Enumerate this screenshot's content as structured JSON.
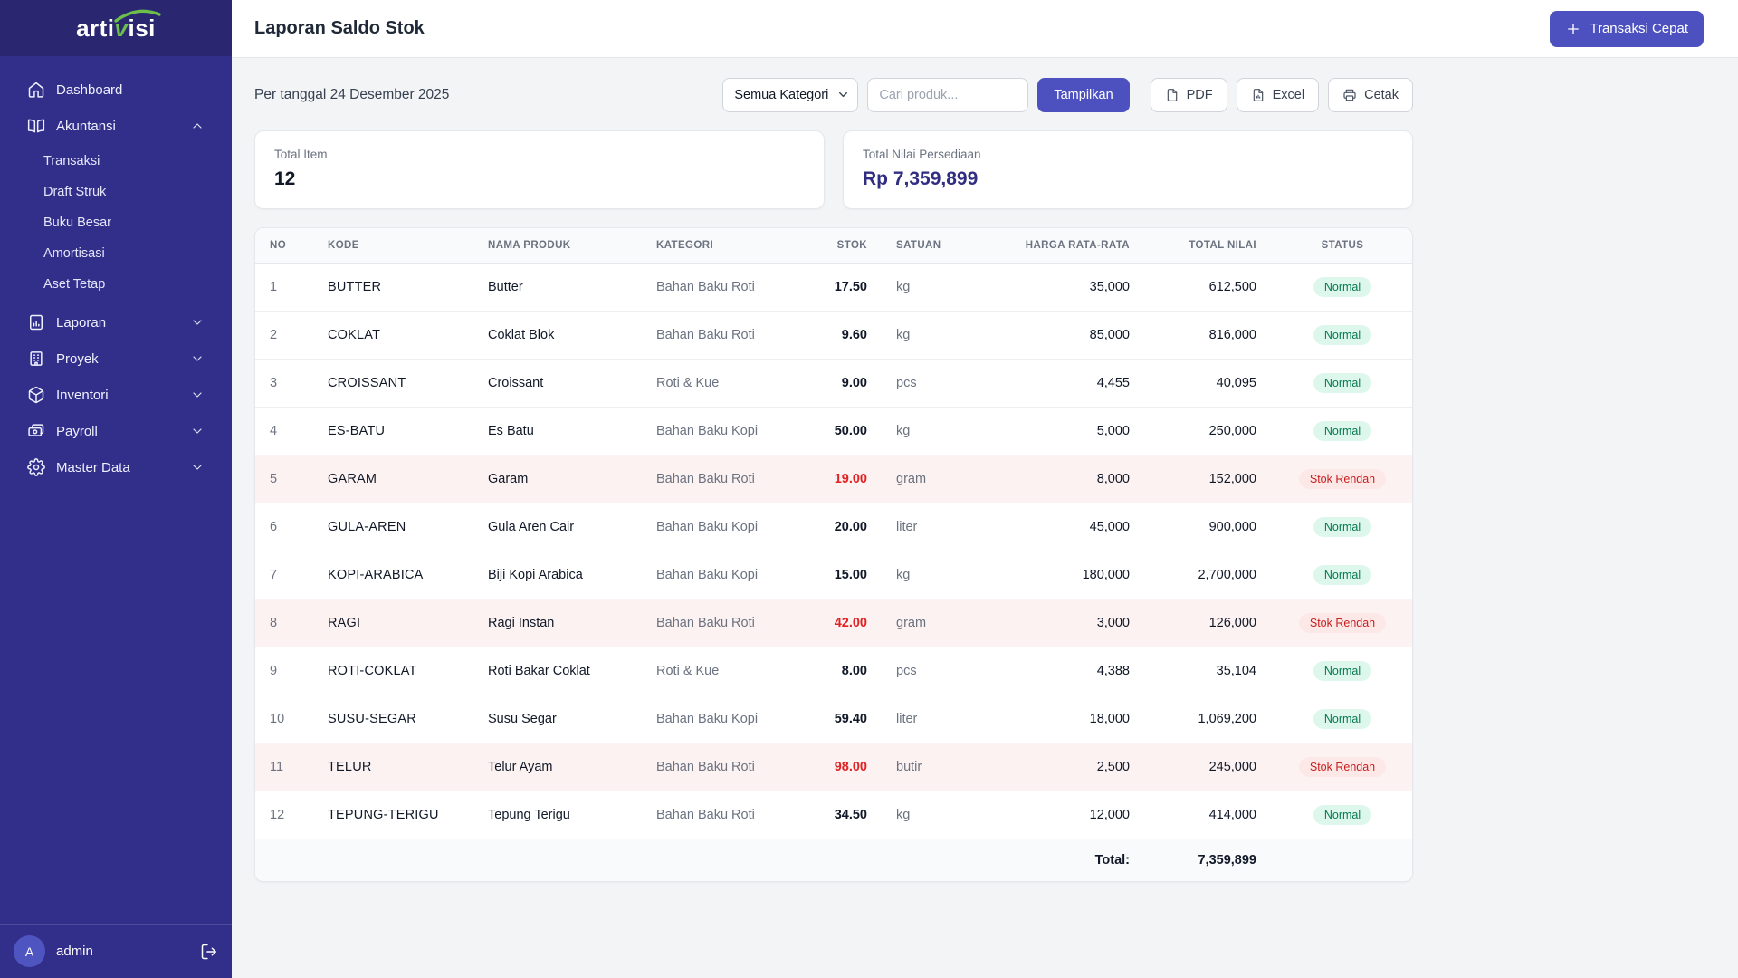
{
  "brand": {
    "part1": "arti",
    "part2": "v",
    "part3": "isi",
    "accent_green": "#6cc04a"
  },
  "sidebar": {
    "items": [
      {
        "label": "Dashboard",
        "icon": "home",
        "chevron": null
      },
      {
        "label": "Akuntansi",
        "icon": "book-open",
        "chevron": "up",
        "children": [
          "Transaksi",
          "Draft Struk",
          "Buku Besar",
          "Amortisasi",
          "Aset Tetap"
        ]
      },
      {
        "label": "Laporan",
        "icon": "report",
        "chevron": "down"
      },
      {
        "label": "Proyek",
        "icon": "building",
        "chevron": "down"
      },
      {
        "label": "Inventori",
        "icon": "box",
        "chevron": "down"
      },
      {
        "label": "Payroll",
        "icon": "cash",
        "chevron": "down"
      },
      {
        "label": "Master Data",
        "icon": "gear",
        "chevron": "down"
      }
    ],
    "user": {
      "initial": "A",
      "name": "admin"
    }
  },
  "header": {
    "title": "Laporan Saldo Stok",
    "quick_action_label": "Transaksi Cepat"
  },
  "filters": {
    "date_label": "Per tanggal 24 Desember 2025",
    "category_selected": "Semua Kategori",
    "search_placeholder": "Cari produk...",
    "show_label": "Tampilkan",
    "pdf_label": "PDF",
    "excel_label": "Excel",
    "print_label": "Cetak"
  },
  "summary": [
    {
      "label": "Total Item",
      "value": "12"
    },
    {
      "label": "Total Nilai Persediaan",
      "value": "Rp 7,359,899"
    }
  ],
  "table": {
    "columns": [
      "No",
      "Kode",
      "Nama Produk",
      "Kategori",
      "Stok",
      "Satuan",
      "Harga Rata-Rata",
      "Total Nilai",
      "Status"
    ],
    "rows": [
      {
        "no": "1",
        "kode": "BUTTER",
        "nama": "Butter",
        "kategori": "Bahan Baku Roti",
        "stok": "17.50",
        "satuan": "kg",
        "harga": "35,000",
        "total": "612,500",
        "status": "Normal",
        "low": false
      },
      {
        "no": "2",
        "kode": "COKLAT",
        "nama": "Coklat Blok",
        "kategori": "Bahan Baku Roti",
        "stok": "9.60",
        "satuan": "kg",
        "harga": "85,000",
        "total": "816,000",
        "status": "Normal",
        "low": false
      },
      {
        "no": "3",
        "kode": "CROISSANT",
        "nama": "Croissant",
        "kategori": "Roti & Kue",
        "stok": "9.00",
        "satuan": "pcs",
        "harga": "4,455",
        "total": "40,095",
        "status": "Normal",
        "low": false
      },
      {
        "no": "4",
        "kode": "ES-BATU",
        "nama": "Es Batu",
        "kategori": "Bahan Baku Kopi",
        "stok": "50.00",
        "satuan": "kg",
        "harga": "5,000",
        "total": "250,000",
        "status": "Normal",
        "low": false
      },
      {
        "no": "5",
        "kode": "GARAM",
        "nama": "Garam",
        "kategori": "Bahan Baku Roti",
        "stok": "19.00",
        "satuan": "gram",
        "harga": "8,000",
        "total": "152,000",
        "status": "Stok Rendah",
        "low": true
      },
      {
        "no": "6",
        "kode": "GULA-AREN",
        "nama": "Gula Aren Cair",
        "kategori": "Bahan Baku Kopi",
        "stok": "20.00",
        "satuan": "liter",
        "harga": "45,000",
        "total": "900,000",
        "status": "Normal",
        "low": false
      },
      {
        "no": "7",
        "kode": "KOPI-ARABICA",
        "nama": "Biji Kopi Arabica",
        "kategori": "Bahan Baku Kopi",
        "stok": "15.00",
        "satuan": "kg",
        "harga": "180,000",
        "total": "2,700,000",
        "status": "Normal",
        "low": false
      },
      {
        "no": "8",
        "kode": "RAGI",
        "nama": "Ragi Instan",
        "kategori": "Bahan Baku Roti",
        "stok": "42.00",
        "satuan": "gram",
        "harga": "3,000",
        "total": "126,000",
        "status": "Stok Rendah",
        "low": true
      },
      {
        "no": "9",
        "kode": "ROTI-COKLAT",
        "nama": "Roti Bakar Coklat",
        "kategori": "Roti & Kue",
        "stok": "8.00",
        "satuan": "pcs",
        "harga": "4,388",
        "total": "35,104",
        "status": "Normal",
        "low": false
      },
      {
        "no": "10",
        "kode": "SUSU-SEGAR",
        "nama": "Susu Segar",
        "kategori": "Bahan Baku Kopi",
        "stok": "59.40",
        "satuan": "liter",
        "harga": "18,000",
        "total": "1,069,200",
        "status": "Normal",
        "low": false
      },
      {
        "no": "11",
        "kode": "TELUR",
        "nama": "Telur Ayam",
        "kategori": "Bahan Baku Roti",
        "stok": "98.00",
        "satuan": "butir",
        "harga": "2,500",
        "total": "245,000",
        "status": "Stok Rendah",
        "low": true
      },
      {
        "no": "12",
        "kode": "TEPUNG-TERIGU",
        "nama": "Tepung Terigu",
        "kategori": "Bahan Baku Roti",
        "stok": "34.50",
        "satuan": "kg",
        "harga": "12,000",
        "total": "414,000",
        "status": "Normal",
        "low": false
      }
    ],
    "footer": {
      "label": "Total:",
      "value": "7,359,899"
    }
  },
  "colors": {
    "sidebar_bg": "#322f8a",
    "sidebar_header_bg": "#2a2770",
    "primary": "#4c51bf",
    "accent_value": "#312e81",
    "badge_normal_bg": "#def7ec",
    "badge_normal_text": "#057a55",
    "badge_low_bg": "#fde8e8",
    "badge_low_text": "#c81e1e",
    "low_row_bg": "#fdf2f2",
    "stok_low_text": "#e02424"
  }
}
